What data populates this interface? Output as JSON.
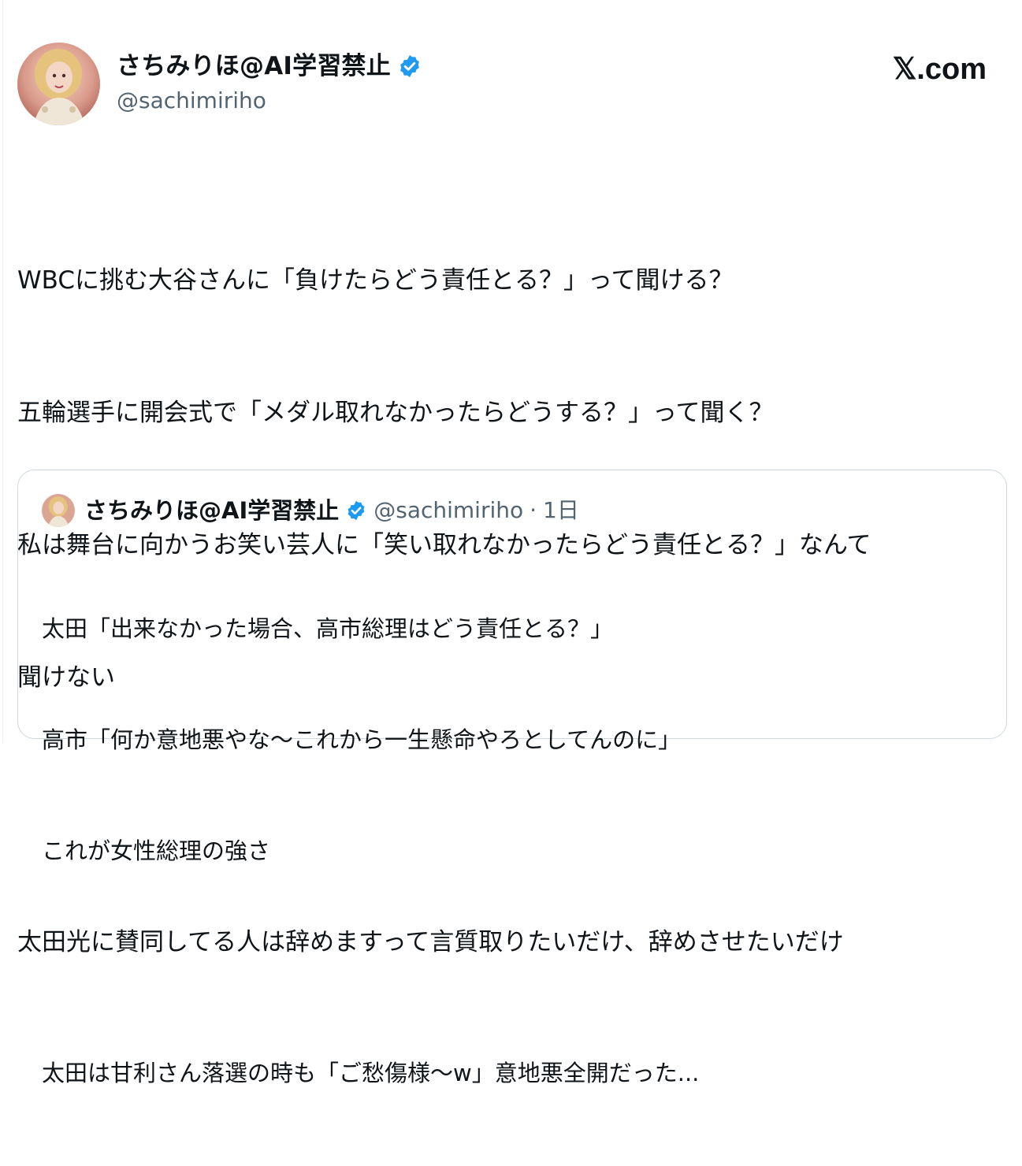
{
  "header": {
    "display_name": "さちみりほ@AI学習禁止",
    "handle": "@sachimiriho",
    "site_brand": "𝕏.com"
  },
  "tweet": {
    "lines": [
      "WBCに挑む大谷さんに「負けたらどう責任とる？」って聞ける？",
      "五輪選手に開会式で「メダル取れなかったらどうする？」って聞く？",
      "私は舞台に向かうお笑い芸人に「笑い取れなかったらどう責任とる？」なんて",
      "聞けない",
      "",
      "太田光に賛同してる人は辞めますって言質取りたいだけ、辞めさせたいだけ"
    ]
  },
  "quote": {
    "display_name": "さちみりほ@AI学習禁止",
    "handle": "@sachimiriho",
    "separator": "·",
    "time": "1日",
    "lines": [
      "太田「出来なかった場合、高市総理はどう責任とる？」",
      "高市「何か意地悪やな〜これから一生懸命やろとしてんのに」",
      "これが女性総理の強さ",
      "",
      "太田は甘利さん落選の時も「ご愁傷様〜w」意地悪全開だった..."
    ]
  },
  "colors": {
    "text": "#0f1419",
    "secondary": "#536471",
    "verified": "#1d9bf0",
    "border": "#cfd9de"
  },
  "icons": {
    "verified": "verified-badge-icon",
    "avatar": "profile-photo"
  }
}
